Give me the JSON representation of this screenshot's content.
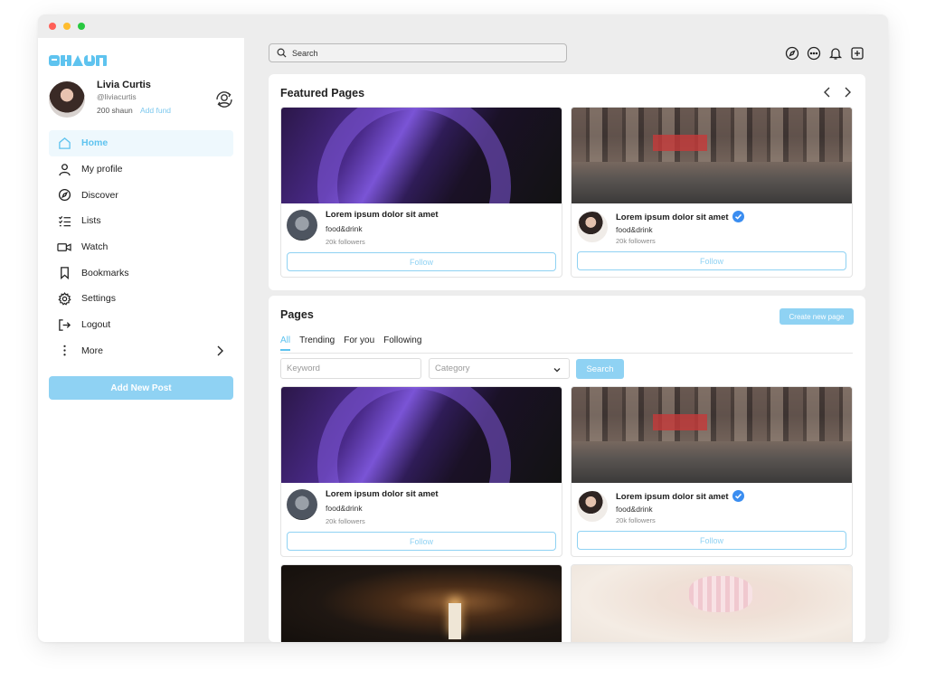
{
  "app": {
    "brand": "SHAUN"
  },
  "user": {
    "name": "Livia Curtis",
    "handle": "@liviacurtis",
    "coins": "200 shaun",
    "add_fund": "Add fund"
  },
  "sidebar": {
    "items": [
      {
        "label": "Home",
        "icon": "home-icon",
        "active": true
      },
      {
        "label": "My profile",
        "icon": "user-icon"
      },
      {
        "label": "Discover",
        "icon": "compass-icon"
      },
      {
        "label": "Lists",
        "icon": "list-icon"
      },
      {
        "label": "Watch",
        "icon": "video-icon"
      },
      {
        "label": "Bookmarks",
        "icon": "bookmark-icon"
      },
      {
        "label": "Settings",
        "icon": "gear-icon"
      },
      {
        "label": "Logout",
        "icon": "logout-icon"
      },
      {
        "label": "More",
        "icon": "more-vertical-icon"
      }
    ],
    "add_post": "Add New Post"
  },
  "topbar": {
    "search_placeholder": "Search",
    "icons": [
      "compass-icon",
      "chat-icon",
      "bell-icon",
      "plus-square-icon"
    ]
  },
  "featured": {
    "title": "Featured Pages",
    "cards": [
      {
        "title": "Lorem ipsum dolor sit amet",
        "category": "food&drink",
        "followers": "20k followers",
        "verified": false,
        "button": "Follow"
      },
      {
        "title": "Lorem ipsum dolor sit amet",
        "category": "food&drink",
        "followers": "20k followers",
        "verified": true,
        "button": "Follow"
      }
    ]
  },
  "pages": {
    "title": "Pages",
    "create_button": "Create new page",
    "tabs": [
      "All",
      "Trending",
      "For you",
      "Following"
    ],
    "keyword_placeholder": "Keyword",
    "category_placeholder": "Category",
    "search_button": "Search",
    "cards": [
      {
        "title": "Lorem ipsum dolor sit amet",
        "category": "food&drink",
        "followers": "20k followers",
        "verified": false,
        "button": "Follow"
      },
      {
        "title": "Lorem ipsum dolor sit amet",
        "category": "food&drink",
        "followers": "20k followers",
        "verified": true,
        "button": "Follow"
      }
    ]
  },
  "colors": {
    "accent": "#5ec3ef",
    "accent_light": "#8fd2f3",
    "verified": "#3a8df0",
    "background": "#ededed"
  }
}
